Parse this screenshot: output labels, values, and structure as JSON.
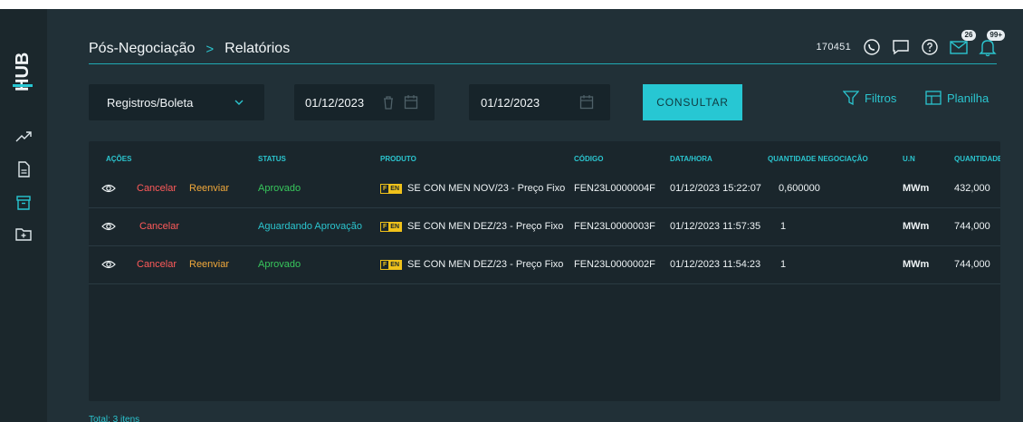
{
  "app": {
    "logo_text": "HUB"
  },
  "header": {
    "breadcrumb": [
      "Pós-Negociação",
      "Relatórios"
    ],
    "breadcrumb_sep": ">",
    "user_id": "170451",
    "mail_badge": "26",
    "bell_badge": "99+"
  },
  "filters": {
    "type_select": "Registros/Boleta",
    "date_from": "01/12/2023",
    "date_to": "01/12/2023",
    "consult_label": "CONSULTAR",
    "filters_label": "Filtros",
    "sheet_label": "Planilha"
  },
  "table": {
    "headers": [
      "AÇÕES",
      "STATUS",
      "PRODUTO",
      "CÓDIGO",
      "DATA/HORA",
      "QUANTIDADE NEGOCIAÇÃO",
      "U.N",
      "QUANTIDADE"
    ],
    "tag": [
      "F",
      "EN"
    ],
    "rows": [
      {
        "cancel": "Cancelar",
        "resend": "Reenviar",
        "status": "Aprovado",
        "produto": "SE CON MEN NOV/23 - Preço Fixo",
        "codigo": "FEN23L0000004F",
        "datahora": "01/12/2023 15:22:07",
        "qtd_neg": "0,600000",
        "un": "MWm",
        "qtd": "432,000"
      },
      {
        "cancel": "Cancelar",
        "resend": "",
        "status": "Aguardando Aprovação",
        "produto": "SE CON MEN DEZ/23 - Preço Fixo",
        "codigo": "FEN23L0000003F",
        "datahora": "01/12/2023 11:57:35",
        "qtd_neg": "1",
        "un": "MWm",
        "qtd": "744,000"
      },
      {
        "cancel": "Cancelar",
        "resend": "Reenviar",
        "status": "Aprovado",
        "produto": "SE CON MEN DEZ/23 - Preço Fixo",
        "codigo": "FEN23L0000002F",
        "datahora": "01/12/2023 11:54:23",
        "qtd_neg": "1",
        "un": "MWm",
        "qtd": "744,000"
      }
    ]
  },
  "footer": {
    "total": "Total: 3 itens"
  },
  "colors": {
    "accent": "#2bc5cf",
    "cancel": "#ff5a5a",
    "resend": "#f2a93b",
    "approved": "#38c75c",
    "tag": "#f0c21a"
  }
}
